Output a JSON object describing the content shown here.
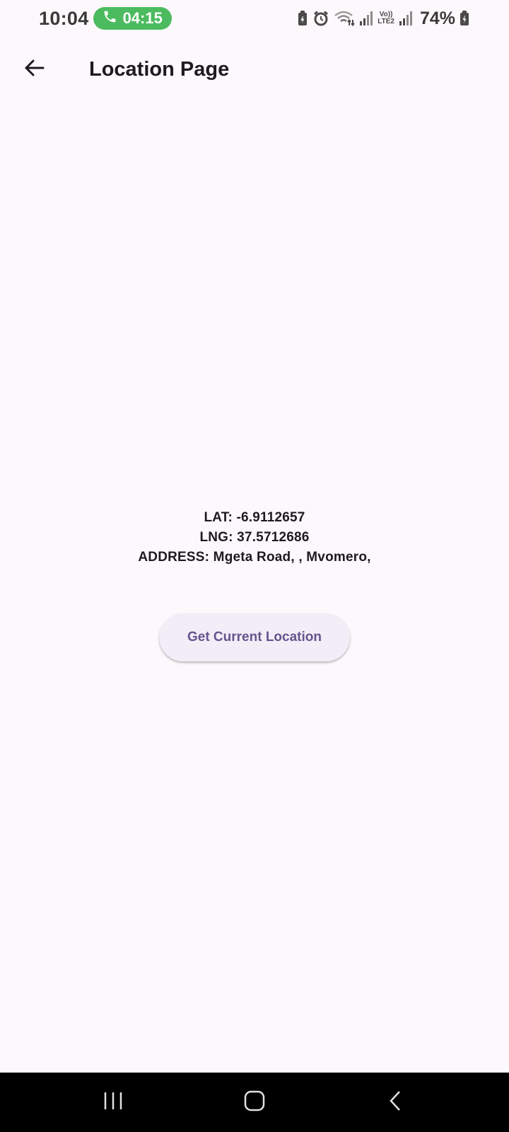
{
  "status_bar": {
    "time": "10:04",
    "call_duration": "04:15",
    "network_label_top": "Vo))",
    "network_label_bottom": "LTE2",
    "battery_percent": "74%",
    "icons": [
      "battery-saver-icon",
      "alarm-icon",
      "wifi-icon",
      "signal-icon",
      "volte-icon",
      "signal-icon",
      "battery-charging-icon"
    ]
  },
  "app_bar": {
    "title": "Location Page",
    "back_icon": "arrow-back-icon"
  },
  "location": {
    "lat": "LAT: -6.9112657",
    "lng": "LNG: 37.5712686",
    "address": "ADDRESS: Mgeta Road, , Mvomero,"
  },
  "actions": {
    "get_location_label": "Get Current Location"
  },
  "nav_bar": {
    "icons": [
      "recent-apps-icon",
      "home-icon",
      "back-icon"
    ]
  },
  "colors": {
    "background": "#fdf8fc",
    "call_pill": "#4cbb5f",
    "button_bg": "#f3edf7",
    "button_text": "#65558f",
    "nav_bar": "#000000"
  }
}
